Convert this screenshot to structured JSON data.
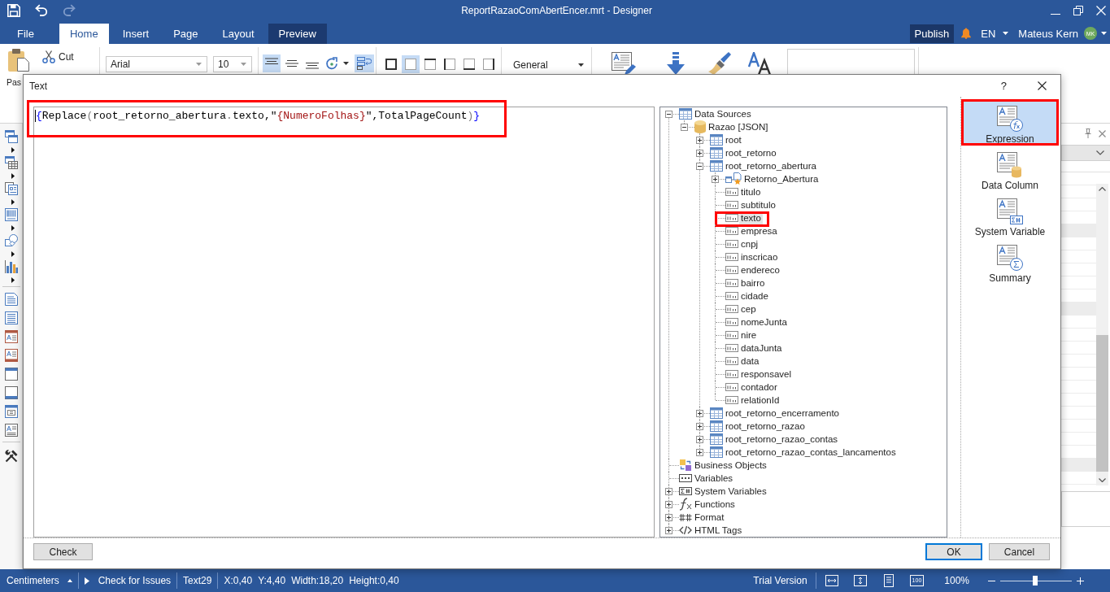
{
  "window": {
    "title": "ReportRazaoComAbertEncer.mrt - Designer"
  },
  "quick_access": [
    {
      "kind": "save",
      "disabled": false
    },
    {
      "kind": "undo",
      "disabled": false
    },
    {
      "kind": "redo",
      "disabled": true
    }
  ],
  "ribbon_tabs": [
    {
      "label": "File",
      "kind": "plain",
      "selected": false
    },
    {
      "label": "Home",
      "kind": "plain",
      "selected": true
    },
    {
      "label": "Insert",
      "kind": "plain",
      "selected": false
    },
    {
      "label": "Page",
      "kind": "plain",
      "selected": false
    },
    {
      "label": "Layout",
      "kind": "plain",
      "selected": false
    },
    {
      "label": "Preview",
      "kind": "accent",
      "selected": false
    }
  ],
  "account": {
    "publish": "Publish",
    "language": "EN",
    "user": "Mateus Kern",
    "initials": "MK"
  },
  "ribbon": {
    "paste": "Pas",
    "cut": "Cut",
    "font": "Arial",
    "font_size": "10",
    "vertical_alignment": [
      {
        "kind": "top",
        "selected": true
      },
      {
        "kind": "center",
        "selected": false
      },
      {
        "kind": "bottom",
        "selected": false
      }
    ],
    "word_wrap": {
      "selected": true
    },
    "borders": [
      {
        "kind": "all",
        "selected": false
      },
      {
        "kind": "none",
        "selected": true
      },
      {
        "kind": "top",
        "selected": false
      },
      {
        "kind": "left",
        "selected": false
      },
      {
        "kind": "bottom",
        "selected": false
      },
      {
        "kind": "right",
        "selected": false
      }
    ],
    "format": "General"
  },
  "dialog": {
    "title": "Text",
    "help": "?",
    "editor": {
      "highlighted": true,
      "tokens": [
        {
          "text": "{",
          "kind": "brace"
        },
        {
          "text": "Replace",
          "kind": "name"
        },
        {
          "text": "(",
          "kind": "operator"
        },
        {
          "text": "root_retorno_abertura",
          "kind": "name"
        },
        {
          "text": ".",
          "kind": "operator"
        },
        {
          "text": "texto,\"",
          "kind": "name"
        },
        {
          "text": "{NumeroFolhas}",
          "kind": "string"
        },
        {
          "text": "\",TotalPageCount",
          "kind": "name"
        },
        {
          "text": ")",
          "kind": "operator"
        },
        {
          "text": "}",
          "kind": "brace"
        }
      ]
    },
    "tree": [
      {
        "label": "Data Sources",
        "kind": "table",
        "expanded": true,
        "selected": false,
        "highlighted": false,
        "children": [
          {
            "label": "Razao [JSON]",
            "kind": "database",
            "expanded": true,
            "selected": false,
            "highlighted": false,
            "children": [
              {
                "label": "root",
                "kind": "table",
                "expanded": false,
                "selected": false,
                "highlighted": false
              },
              {
                "label": "root_retorno",
                "kind": "table",
                "expanded": false,
                "selected": false,
                "highlighted": false
              },
              {
                "label": "root_retorno_abertura",
                "kind": "table",
                "expanded": true,
                "selected": false,
                "highlighted": false,
                "children": [
                  {
                    "label": "Retorno_Abertura",
                    "kind": "relation",
                    "expanded": false,
                    "selected": false,
                    "highlighted": false
                  },
                  {
                    "label": "titulo",
                    "kind": "column",
                    "selected": false,
                    "highlighted": false
                  },
                  {
                    "label": "subtitulo",
                    "kind": "column",
                    "selected": false,
                    "highlighted": false
                  },
                  {
                    "label": "texto",
                    "kind": "column",
                    "selected": true,
                    "highlighted": true
                  },
                  {
                    "label": "empresa",
                    "kind": "column",
                    "selected": false,
                    "highlighted": false
                  },
                  {
                    "label": "cnpj",
                    "kind": "column",
                    "selected": false,
                    "highlighted": false
                  },
                  {
                    "label": "inscricao",
                    "kind": "column",
                    "selected": false,
                    "highlighted": false
                  },
                  {
                    "label": "endereco",
                    "kind": "column",
                    "selected": false,
                    "highlighted": false
                  },
                  {
                    "label": "bairro",
                    "kind": "column",
                    "selected": false,
                    "highlighted": false
                  },
                  {
                    "label": "cidade",
                    "kind": "column",
                    "selected": false,
                    "highlighted": false
                  },
                  {
                    "label": "cep",
                    "kind": "column",
                    "selected": false,
                    "highlighted": false
                  },
                  {
                    "label": "nomeJunta",
                    "kind": "column",
                    "selected": false,
                    "highlighted": false
                  },
                  {
                    "label": "nire",
                    "kind": "column",
                    "selected": false,
                    "highlighted": false
                  },
                  {
                    "label": "dataJunta",
                    "kind": "column",
                    "selected": false,
                    "highlighted": false
                  },
                  {
                    "label": "data",
                    "kind": "column",
                    "selected": false,
                    "highlighted": false
                  },
                  {
                    "label": "responsavel",
                    "kind": "column",
                    "selected": false,
                    "highlighted": false
                  },
                  {
                    "label": "contador",
                    "kind": "column",
                    "selected": false,
                    "highlighted": false
                  },
                  {
                    "label": "relationId",
                    "kind": "column",
                    "selected": false,
                    "highlighted": false
                  }
                ]
              },
              {
                "label": "root_retorno_encerramento",
                "kind": "table",
                "expanded": false,
                "selected": false,
                "highlighted": false
              },
              {
                "label": "root_retorno_razao",
                "kind": "table",
                "expanded": false,
                "selected": false,
                "highlighted": false
              },
              {
                "label": "root_retorno_razao_contas",
                "kind": "table",
                "expanded": false,
                "selected": false,
                "highlighted": false
              },
              {
                "label": "root_retorno_razao_contas_lancamentos",
                "kind": "table",
                "expanded": false,
                "selected": false,
                "highlighted": false
              }
            ]
          }
        ]
      },
      {
        "label": "Business Objects",
        "kind": "business-objects",
        "selected": false,
        "highlighted": false
      },
      {
        "label": "Variables",
        "kind": "variables",
        "selected": false,
        "highlighted": false
      },
      {
        "label": "System Variables",
        "kind": "system-variables",
        "expanded": false,
        "selected": false,
        "highlighted": false
      },
      {
        "label": "Functions",
        "kind": "functions",
        "expanded": false,
        "selected": false,
        "highlighted": false
      },
      {
        "label": "Format",
        "kind": "format",
        "expanded": false,
        "selected": false,
        "highlighted": false
      },
      {
        "label": "HTML Tags",
        "kind": "html-tags",
        "expanded": false,
        "selected": false,
        "highlighted": false
      }
    ],
    "insert_buttons": [
      {
        "kind": "expression",
        "label": "Expression",
        "selected": true,
        "highlighted": true
      },
      {
        "kind": "data-column",
        "label": "Data Column",
        "selected": false,
        "highlighted": false
      },
      {
        "kind": "system-variable",
        "label": "System Variable",
        "selected": false,
        "highlighted": false
      },
      {
        "kind": "summary",
        "label": "Summary",
        "selected": false,
        "highlighted": false
      }
    ],
    "footer_buttons": [
      {
        "label": "Check",
        "default": false
      },
      {
        "label": "OK",
        "default": true
      },
      {
        "label": "Cancel",
        "default": false
      }
    ]
  },
  "status_bar": {
    "units": "Centimeters",
    "check": "Check for Issues",
    "component": "Text29",
    "geometry": [
      "X:0,40",
      "Y:4,40",
      "Width:18,20",
      "Height:0,40"
    ],
    "license": "Trial Version",
    "actual_size": "100",
    "zoom": "100%",
    "zoom_slider": {
      "level": 0.49
    }
  }
}
